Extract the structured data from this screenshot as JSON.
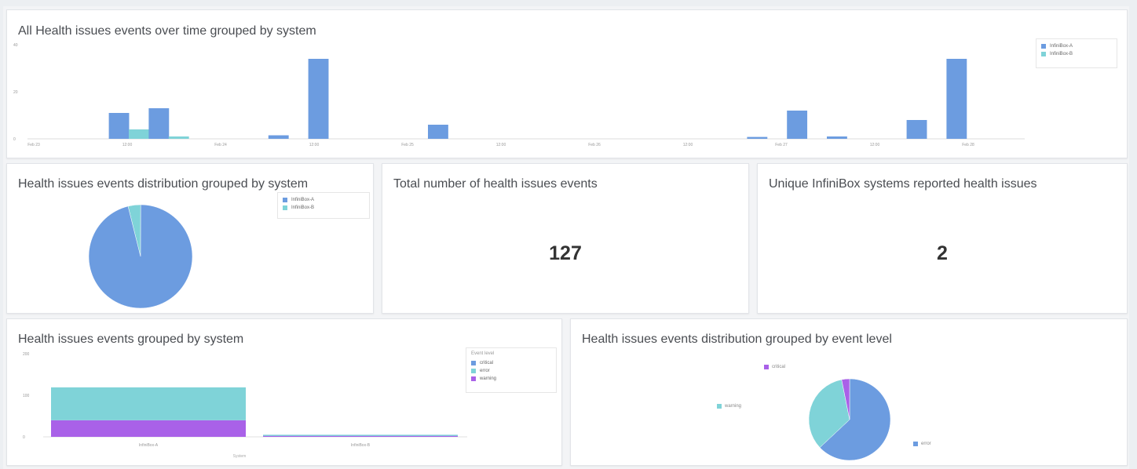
{
  "colors": {
    "blue": "#6c9ce0",
    "teal": "#7fd3d8",
    "purple": "#a961e8",
    "text": "#4a4d52"
  },
  "panels": {
    "timeline": {
      "title": "All Health issues events over time grouped by system",
      "legend": [
        "InfiniBox-A",
        "InfiniBox-B"
      ]
    },
    "distribution_system": {
      "title": "Health issues events distribution grouped by system",
      "legend": [
        "InfiniBox-A",
        "InfiniBox-B"
      ]
    },
    "total_events": {
      "title": "Total number of health issues events",
      "value": "127"
    },
    "unique_systems": {
      "title": "Unique InfiniBox systems reported health issues",
      "value": "2"
    },
    "grouped_system": {
      "title": "Health issues events grouped by system",
      "legend_title": "Event level",
      "legend": [
        "critical",
        "error",
        "warning"
      ],
      "xlabel": "System"
    },
    "distribution_level": {
      "title": "Health issues events distribution grouped by event level",
      "labels": {
        "critical": "critical",
        "warning": "warning",
        "error": "error"
      }
    }
  },
  "chart_data": [
    {
      "type": "bar",
      "name": "timeline",
      "x_ticks": [
        "Feb 23",
        "12:00",
        "Feb 24",
        "12:00",
        "Feb 25",
        "12:00",
        "Feb 26",
        "12:00",
        "Feb 27",
        "12:00",
        "Feb 28"
      ],
      "ylim": [
        0,
        40
      ],
      "y_ticks": [
        "0",
        "20",
        "40"
      ],
      "x_positions": [
        0.5,
        1,
        1.5,
        2,
        2.5,
        3,
        3.5,
        4,
        4.5,
        5,
        5.5,
        6,
        6.5,
        7,
        7.5,
        8,
        8.5,
        9,
        9.5,
        10,
        10.5,
        11,
        11.5,
        12,
        12.5,
        13,
        13.5,
        14,
        14.5,
        15,
        15.5,
        16,
        16.5,
        17,
        17.5,
        18,
        18.5,
        19,
        19.5,
        20,
        20.5,
        21
      ],
      "series": [
        {
          "name": "InfiniBox-A",
          "values": [
            0,
            0,
            0,
            0,
            11,
            0,
            13,
            0,
            0,
            0,
            0,
            0,
            0,
            0,
            0,
            0,
            1.5,
            0,
            34,
            0,
            0,
            0,
            0,
            0,
            0,
            0,
            0,
            0,
            0,
            0,
            0,
            0,
            0,
            0,
            0,
            0,
            0,
            0,
            0,
            0,
            0,
            0,
            0,
            0,
            0,
            0,
            0,
            0,
            0,
            0,
            0,
            0,
            0,
            0,
            0,
            0,
            0,
            0
          ]
        },
        {
          "name": "InfiniBox-B",
          "values": [
            0,
            0,
            0,
            0,
            0,
            4,
            0,
            1,
            0,
            0,
            0,
            0,
            0,
            0,
            0,
            0,
            0,
            0,
            0,
            0,
            0,
            0,
            0,
            0,
            0,
            0,
            0,
            0,
            0,
            0,
            0,
            0,
            0,
            0,
            0,
            0,
            0,
            0,
            0,
            0,
            0,
            0,
            0,
            0,
            0,
            0,
            0,
            0,
            0,
            0,
            0,
            0,
            0,
            0,
            0,
            0,
            0,
            0
          ]
        }
      ],
      "bars": [
        {
          "slot": 4,
          "series": "InfiniBox-A",
          "value": 11
        },
        {
          "slot": 5,
          "series": "InfiniBox-B",
          "value": 4
        },
        {
          "slot": 6,
          "series": "InfiniBox-A",
          "value": 13
        },
        {
          "slot": 7,
          "series": "InfiniBox-B",
          "value": 1
        },
        {
          "slot": 12,
          "series": "InfiniBox-A",
          "value": 1.5
        },
        {
          "slot": 14,
          "series": "InfiniBox-A",
          "value": 34
        },
        {
          "slot": 20,
          "series": "InfiniBox-A",
          "value": 6
        },
        {
          "slot": 36,
          "series": "InfiniBox-A",
          "value": 0.8
        },
        {
          "slot": 38,
          "series": "InfiniBox-A",
          "value": 12
        },
        {
          "slot": 40,
          "series": "InfiniBox-A",
          "value": 1
        },
        {
          "slot": 44,
          "series": "InfiniBox-A",
          "value": 8
        },
        {
          "slot": 46,
          "series": "InfiniBox-A",
          "value": 34
        }
      ]
    },
    {
      "type": "pie",
      "name": "distribution_system",
      "labels": [
        "InfiniBox-A",
        "InfiniBox-B"
      ],
      "values": [
        122,
        5
      ]
    },
    {
      "type": "bar",
      "name": "grouped_system",
      "stacked": true,
      "categories": [
        "InfiniBox-A",
        "InfiniBox-B"
      ],
      "ylim": [
        0,
        200
      ],
      "y_ticks": [
        "0",
        "100",
        "200"
      ],
      "series": [
        {
          "name": "warning",
          "values": [
            40,
            3
          ]
        },
        {
          "name": "error",
          "values": [
            79,
            2
          ]
        },
        {
          "name": "critical",
          "values": [
            0,
            0
          ]
        }
      ]
    },
    {
      "type": "pie",
      "name": "distribution_level",
      "labels": [
        "error",
        "warning",
        "critical"
      ],
      "values": [
        80,
        43,
        4
      ]
    }
  ]
}
